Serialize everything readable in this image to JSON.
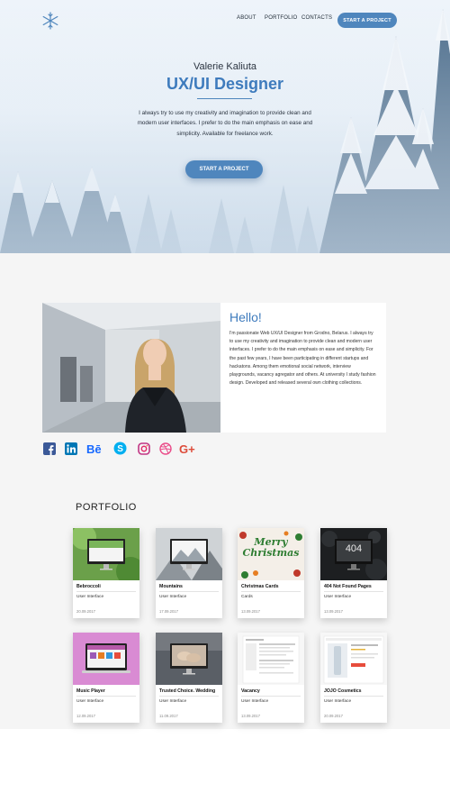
{
  "nav": {
    "links": [
      "ABOUT",
      "PORTFOLIO",
      "CONTACTS"
    ],
    "cta": "START A PROJECT"
  },
  "hero": {
    "name": "Valerie Kaliuta",
    "title": "UX/UI Designer",
    "description": "I always try to use my creativity and imagination to provide clean and modern user interfaces. I prefer to do the main emphasis on ease and simplicity. Available for freelance work.",
    "cta": "START A PROJECT"
  },
  "about": {
    "heading": "Hello!",
    "text": "I'm passionate Web UX/UI Designer from Grodno, Belarus. I always try to use my creativity and imagination to provide clean and modern user interfaces. I prefer to do the main emphasis on ease and simplicity. For the past few years, I have been participating in different startups and hackatons. Among them emotional social network, interview playgrounds, vacancy agregator and others. At university I study fashion design. Developed and released several own clothing collections."
  },
  "socials": [
    "facebook-icon",
    "linkedin-icon",
    "behance-icon",
    "skype-icon",
    "instagram-icon",
    "dribbble-icon",
    "google-plus-icon"
  ],
  "colors": {
    "accent": "#3e7bbd",
    "button": "#4f86bd",
    "facebook": "#3b5998",
    "linkedin": "#0077b5",
    "behance": "#1769ff",
    "skype": "#00aff0",
    "instagram": "#c13584",
    "dribbble": "#ea4c89",
    "google_plus": "#dd4b39"
  },
  "portfolio": {
    "title": "PORTFOLIO",
    "items": [
      {
        "title": "Bebroccoli",
        "category": "User Interface",
        "date": "20.09.2017"
      },
      {
        "title": "Mountains",
        "category": "User Interface",
        "date": "17.09.2017"
      },
      {
        "title": "Christmas Cards",
        "category": "Cards",
        "date": "13.09.2017",
        "thumb_text": "Merry Christmas"
      },
      {
        "title": "404 Not Found Pages",
        "category": "User Interface",
        "date": "13.09.2017",
        "thumb_text": "404"
      },
      {
        "title": "Music Player",
        "category": "User Interface",
        "date": "12.09.2017"
      },
      {
        "title": "Trusted Choice. Wedding",
        "category": "User Interface",
        "date": "11.09.2017"
      },
      {
        "title": "Vacancy",
        "category": "User Interface",
        "date": "13.09.2017"
      },
      {
        "title": "JOJO Cosmetics",
        "category": "User Interface",
        "date": "20.09.2017"
      }
    ]
  }
}
